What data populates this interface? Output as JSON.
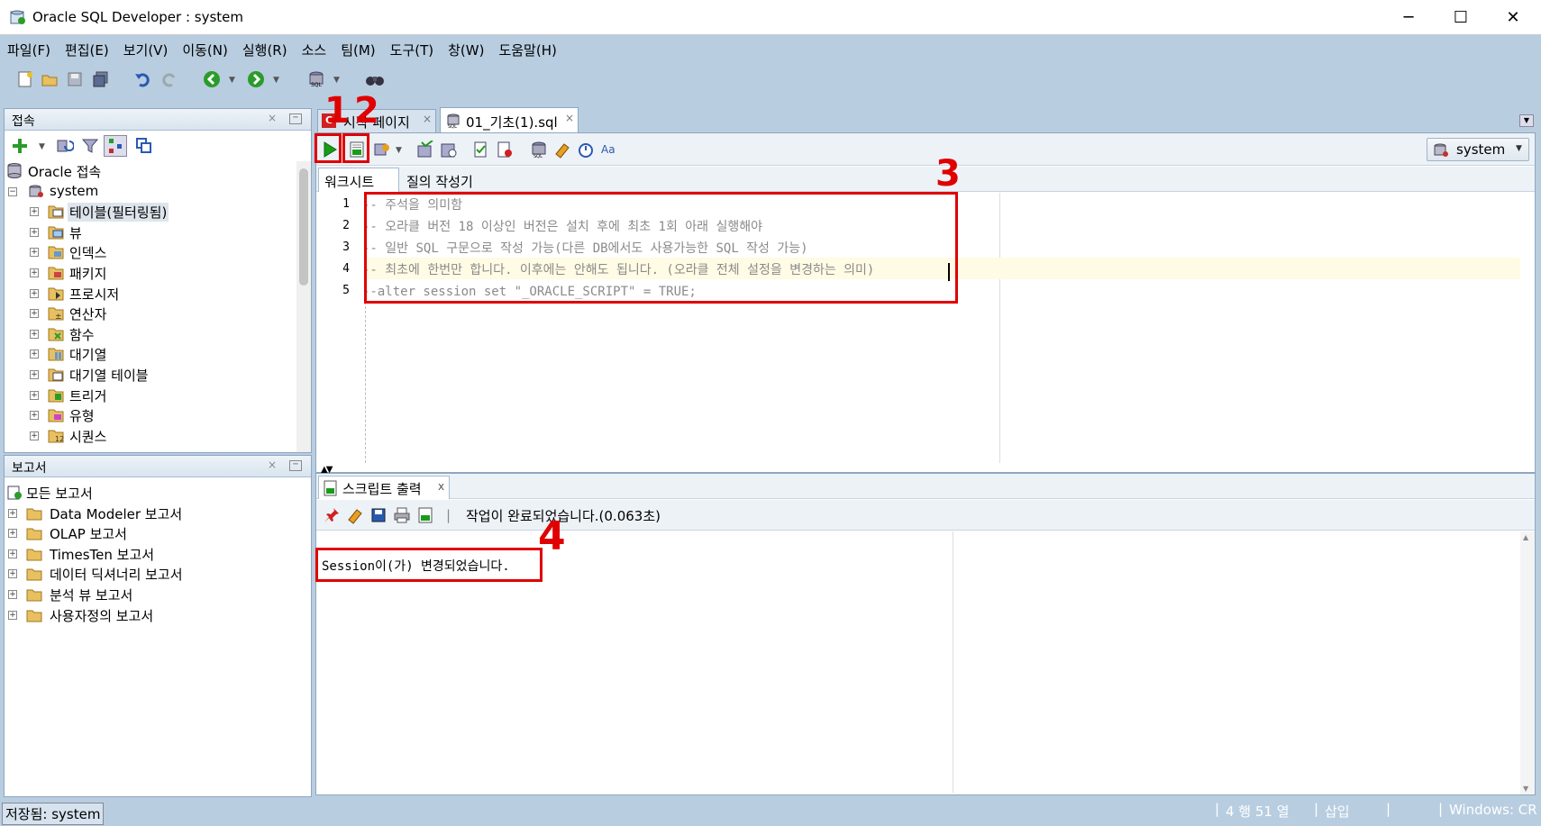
{
  "window": {
    "title": "Oracle SQL Developer : system",
    "controls": [
      "─",
      "☐",
      "✕"
    ]
  },
  "menu": [
    "파일(F)",
    "편집(E)",
    "보기(V)",
    "이동(N)",
    "실행(R)",
    "소스",
    "팀(M)",
    "도구(T)",
    "창(W)",
    "도움말(H)"
  ],
  "connections_panel": {
    "title": "접속",
    "close": "×",
    "root": "Oracle 접속",
    "connection": "system",
    "items": [
      "테이블(필터링됨)",
      "뷰",
      "인덱스",
      "패키지",
      "프로시저",
      "연산자",
      "함수",
      "대기열",
      "대기열 테이블",
      "트리거",
      "유형",
      "시퀀스"
    ]
  },
  "reports_panel": {
    "title": "보고서",
    "close": "×",
    "root": "모든 보고서",
    "items": [
      "Data Modeler 보고서",
      "OLAP 보고서",
      "TimesTen 보고서",
      "데이터 딕셔너리 보고서",
      "분석 뷰 보고서",
      "사용자정의 보고서"
    ]
  },
  "editor": {
    "tabs": [
      {
        "label": "시작 페이지",
        "close": "×"
      },
      {
        "label": "01_기초(1).sql",
        "close": "×"
      }
    ],
    "connection_selector": "system",
    "subtabs": [
      "워크시트",
      "질의 작성기"
    ],
    "line_numbers": [
      "1",
      "2",
      "3",
      "4",
      "5"
    ],
    "code_lines": [
      "-- 주석을 의미함",
      "-- 오라클 버전 18 이상인 버전은 설치 후에 최초 1회 아래 실행해야",
      "-- 일반 SQL 구문으로 작성 가능(다른 DB에서도 사용가능한 SQL 작성 가능)",
      "-- 최초에 한번만 합니다. 이후에는 안해도 됩니다. (오라클 전체 설정을 변경하는 의미)",
      "--alter session set \"_ORACLE_SCRIPT\" = TRUE;"
    ]
  },
  "output_panel": {
    "tab_label": "스크립트 출력",
    "tab_close": "x",
    "status": "작업이 완료되었습니다.(0.063초)",
    "output": "Session이(가) 변경되었습니다."
  },
  "annotations": [
    "1",
    "2",
    "3",
    "4"
  ],
  "statusbar": {
    "left": "저장됨: system",
    "position": "4 행 51 열",
    "mode": "삽입",
    "line_ending": "Windows: CR"
  },
  "colors": {
    "background": "#b8cde0",
    "annotation_red": "#e00000",
    "run_green": "#1a9c1a"
  }
}
